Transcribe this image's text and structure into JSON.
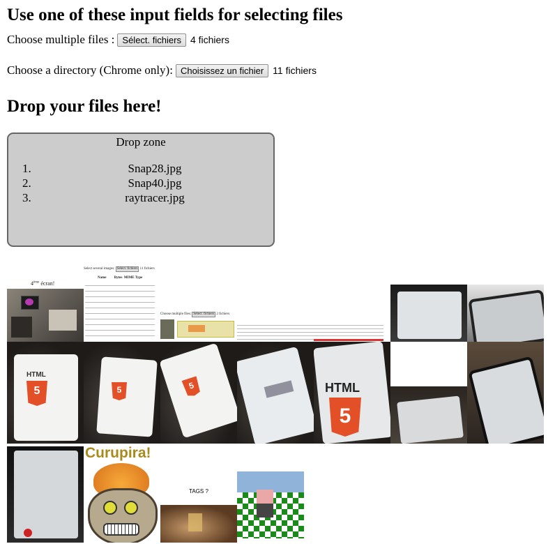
{
  "heading_main": "Use one of these input fields for selecting files",
  "multi": {
    "label": "Choose multiple files :",
    "button": "Sélect. fichiers",
    "count": "4 fichiers"
  },
  "directory": {
    "label": "Choose a directory (Chrome only):",
    "button": "Choisissez un fichier",
    "count": "11 fichiers"
  },
  "heading_drop": "Drop your files here!",
  "dropzone": {
    "title": "Drop zone",
    "files": [
      {
        "num": "1.",
        "name": "Snap28.jpg"
      },
      {
        "num": "2.",
        "name": "Snap40.jpg"
      },
      {
        "num": "3.",
        "name": "raytracer.jpg"
      }
    ]
  },
  "thumb_texts": {
    "ecran_prefix": "4",
    "ecran_sup": "ème",
    "ecran_suffix": " écran!",
    "select_images": "Select several images:",
    "select_btn": "Select. fichiers",
    "select_count": "11 fichiers",
    "col_name": "Name",
    "col_bytes": "Bytes",
    "col_mime": "MIME Type",
    "choose_multi": "Choose multiple files:",
    "choose_btn": "Sélect. fichiers",
    "choose_count": "2 fichiers",
    "curupira": "Curupira!",
    "tags": "TAGS ?",
    "html5": "HTML"
  }
}
